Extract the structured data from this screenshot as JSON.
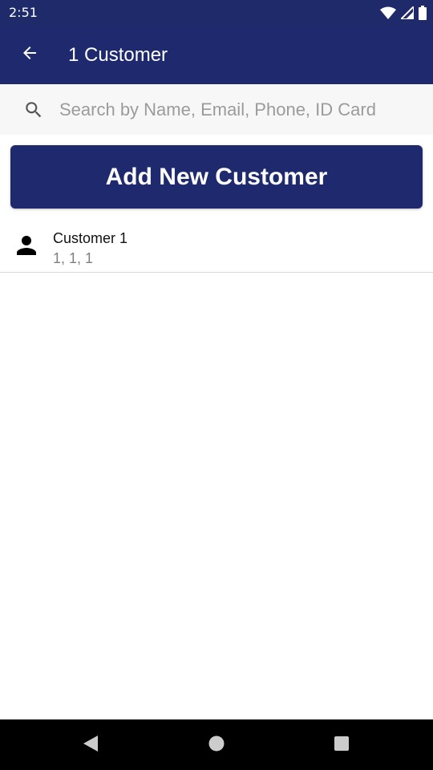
{
  "status_bar": {
    "time": "2:51",
    "icons": [
      "wifi-icon",
      "signal-icon",
      "battery-icon"
    ]
  },
  "app_bar": {
    "back_icon": "arrow-left-icon",
    "title": "1 Customer",
    "background": "#1f2a6e"
  },
  "search": {
    "icon": "search-icon",
    "placeholder": "Search by Name, Email, Phone, ID Card",
    "value": ""
  },
  "add_button": {
    "label": "Add New Customer",
    "color": "#1f2a6e"
  },
  "customers": [
    {
      "icon": "person-icon",
      "name": "Customer 1",
      "details": "1, 1, 1"
    }
  ],
  "nav_bar": {
    "buttons": [
      "back-triangle-icon",
      "home-circle-icon",
      "recents-square-icon"
    ]
  }
}
